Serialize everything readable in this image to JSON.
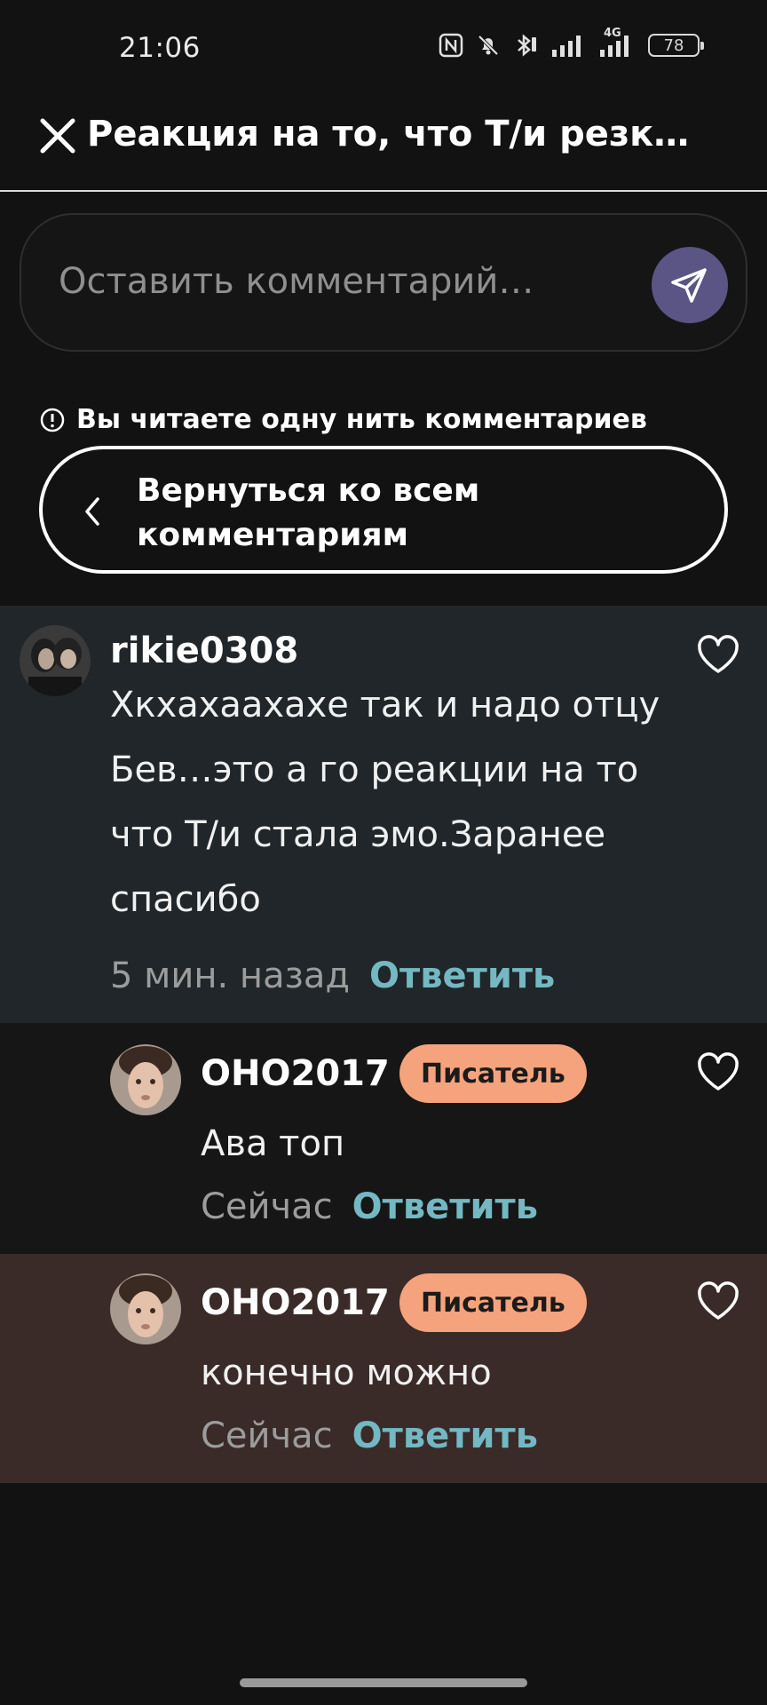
{
  "status_bar": {
    "time": "21:06",
    "battery": "78",
    "network": "4G",
    "icons": [
      "nfc-icon",
      "silent-bell-icon",
      "bluetooth-icon",
      "signal-icon",
      "signal-4g-icon",
      "battery-icon"
    ]
  },
  "header": {
    "title": "Реакция на то, что Т/и резк…",
    "close_icon": "close-icon"
  },
  "comment_input": {
    "placeholder": "Оставить комментарий…",
    "send_icon": "send-icon"
  },
  "thread": {
    "notice": "Вы читаете одну нить комментариев",
    "back_label": "Вернуться ко всем комментариям"
  },
  "comments": [
    {
      "username": "rikie0308",
      "text": "Хкхахаахахе так и надо отцу Бев…это а го реакции на то что Т/и стала эмо.Заранее спасибо",
      "time": "5 мин. назад",
      "reply": "Ответить"
    },
    {
      "username": "OHO2017",
      "badge": "Писатель",
      "text": "Ава топ",
      "time": "Сейчас",
      "reply": "Ответить"
    },
    {
      "username": "OHO2017",
      "badge": "Писатель",
      "text": "конечно можно",
      "time": "Сейчас",
      "reply": "Ответить"
    }
  ],
  "colors": {
    "background": "#121212",
    "accent_reply": "#73b8c2",
    "badge": "#f5a37c",
    "send_button": "#5a5585",
    "highlight_parent": "#202629",
    "highlight_current": "#3a2b29"
  }
}
